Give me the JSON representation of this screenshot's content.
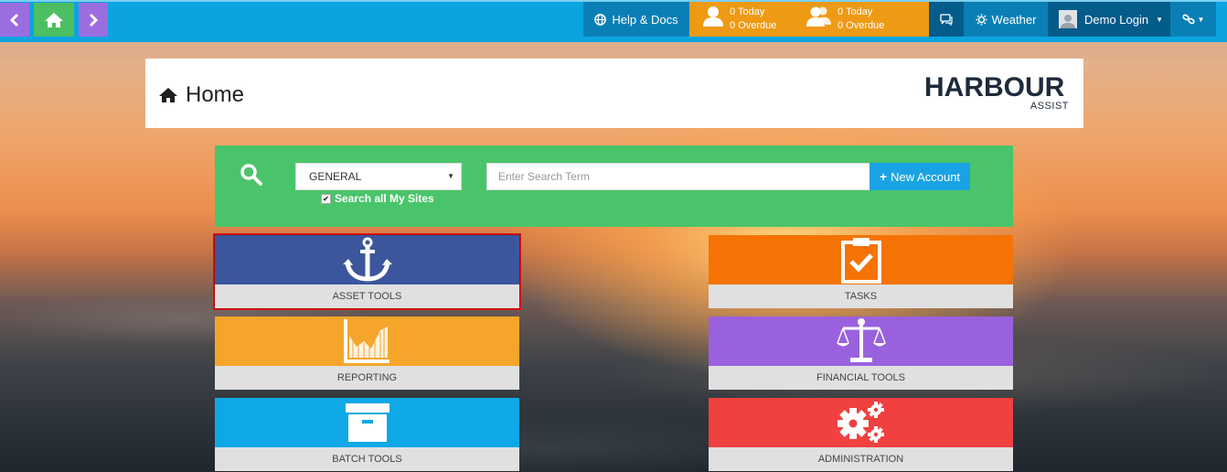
{
  "topbar": {
    "help_label": "Help & Docs",
    "tasks_today": "0 Today",
    "tasks_overdue": "0 Overdue",
    "team_today": "0 Today",
    "team_overdue": "0 Overdue",
    "weather_label": "Weather",
    "user_label": "Demo Login",
    "colors": {
      "bar": "#0ba4e0",
      "reminders": "#ee9a14",
      "dark": "#045c8a"
    }
  },
  "header": {
    "title": "Home",
    "logo_word": "HARBOUR",
    "logo_sub": "ASSIST"
  },
  "search": {
    "category_selected": "GENERAL",
    "search_all_label": "Search all My Sites",
    "search_all_checked": true,
    "placeholder": "Enter Search Term",
    "new_account_label": "New Account"
  },
  "tiles": [
    {
      "label": "ASSET TOOLS",
      "icon": "anchor-icon",
      "color": "#3b569c"
    },
    {
      "label": "TASKS",
      "icon": "clipboard-check-icon",
      "color": "#f57305"
    },
    {
      "label": "REPORTING",
      "icon": "area-chart-icon",
      "color": "#f5a52a"
    },
    {
      "label": "FINANCIAL TOOLS",
      "icon": "balance-scale-icon",
      "color": "#9a61df"
    },
    {
      "label": "BATCH TOOLS",
      "icon": "archive-box-icon",
      "color": "#0ea8e6"
    },
    {
      "label": "ADMINISTRATION",
      "icon": "gears-icon",
      "color": "#f04040"
    }
  ]
}
